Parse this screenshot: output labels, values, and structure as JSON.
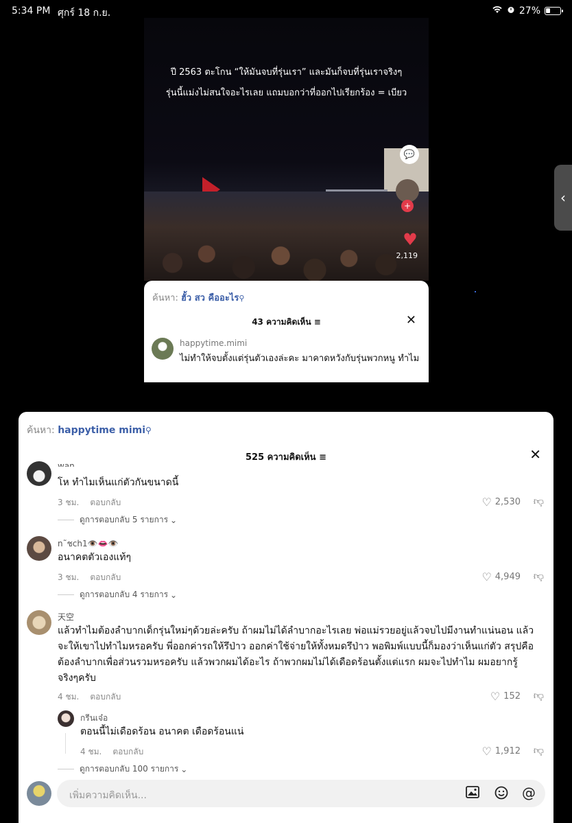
{
  "status_bar": {
    "time": "5:34 PM",
    "date": "ศุกร์ 18 ก.ย.",
    "battery": "27%"
  },
  "video": {
    "caption_line1": "ปี 2563 ตะโกน “ให้มันจบที่รุ่นเรา” และมันก็จบที่รุ่นเราจริงๆ",
    "caption_line2": "รุ่นนี้แม่งไม่สนใจอะไรเลย แถมบอกว่าที่ออกไปเรียกร้อง = เบียว",
    "likes": "2,119"
  },
  "inner_card": {
    "search_label": "ค้นหา:",
    "search_term": "ฮั้ว สว คืออะไร",
    "count": "43 ความคิดเห็น",
    "user": "happytime.mimi",
    "text": "ไม่ทำให้จบตั้งแต่รุ่นตัวเองล่ะคะ มาคาดหวังกับรุ่นพวกหนู ทำไม"
  },
  "sheet": {
    "search_label": "ค้นหา:",
    "search_term": "happytime mimi",
    "count": "525 ความคิดเห็น",
    "input_placeholder": "เพิ่มความคิดเห็น...",
    "comments": [
      {
        "user": "wan",
        "text": "โห ทำไมเห็นแก่ตัวกันขนาดนี้",
        "time": "3 ชม.",
        "reply": "ตอบกลับ",
        "likes": "2,530",
        "view_replies": "ดูการตอบกลับ 5 รายการ"
      },
      {
        "user": "n˜ชch1👁️👄👁️",
        "text": "อนาคตตัวเองแท้ๆ",
        "time": "3 ชม.",
        "reply": "ตอบกลับ",
        "likes": "4,949",
        "view_replies": "ดูการตอบกลับ 4 รายการ"
      },
      {
        "user": "天空",
        "text": "แล้วทำไมต้องลำบากเด็กรุ่นใหม่ๆด้วยล่ะครับ ถ้าผมไม่ได้ลำบากอะไรเลย พ่อแม่รวยอยู่แล้วจบไปมีงานทำแน่นอน แล้วจะให้เขาไปทำไมหรอครับ พี่ออกค่ารถให้รึป่าว ออกค่าใช้จ่ายให้ทั้งหมดรึป่าว พอพิมพ์แบบนี้ก็มองว่าเห็นแก่ตัว สรุปคือต้องลำบากเพื่อส่วนรวมหรอครับ แล้วพวกผมได้อะไร ถ้าพวกผมไม่ได้เดือดร้อนตั้งแต่แรก ผมจะไปทำไม ผมอยากรู้จริงๆครับ",
        "time": "4 ชม.",
        "reply": "ตอบกลับ",
        "likes": "152",
        "view_replies": "ดูการตอบกลับ 100 รายการ"
      }
    ],
    "nested_reply": {
      "user": "กรีนเจ๋อ",
      "text": "ตอนนี้ไม่เดือดร้อน  อนาคต เดือดร้อนแน่",
      "time": "4 ชม.",
      "reply": "ตอบกลับ",
      "likes": "1,912"
    }
  },
  "colors": {
    "link_blue": "#3c5fa8",
    "heart_red": "#e23b4a"
  },
  "icons": [
    "wifi-icon",
    "alarm-icon",
    "battery-icon",
    "close-icon",
    "search-icon",
    "heart-icon",
    "dislike-icon",
    "image-icon",
    "emoji-icon",
    "mention-icon",
    "chevron-left-icon"
  ]
}
